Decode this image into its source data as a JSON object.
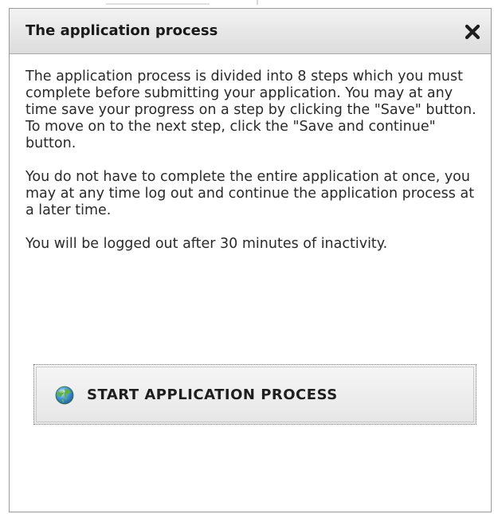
{
  "dialog": {
    "title": "The application process",
    "close_icon": "close-icon",
    "paragraphs": [
      "The application process is divided into 8 steps which you must complete before submitting your application. You may at any time save your progress on a step by clicking the \"Save\" button. To move on to the next step, click the \"Save and continue\" button.",
      "You do not have to complete the entire application at once, you may at any time log out and continue the application process at a later time.",
      "You will be logged out after 30 minutes of inactivity."
    ],
    "start_button": {
      "label": "START APPLICATION PROCESS",
      "icon": "globe-icon"
    }
  },
  "colors": {
    "titlebar_top": "#f3f3f3",
    "titlebar_bottom": "#dcdcdc",
    "text": "#2a2a2a",
    "globe_green": "#5fb33a",
    "globe_blue": "#3d8fd6"
  }
}
